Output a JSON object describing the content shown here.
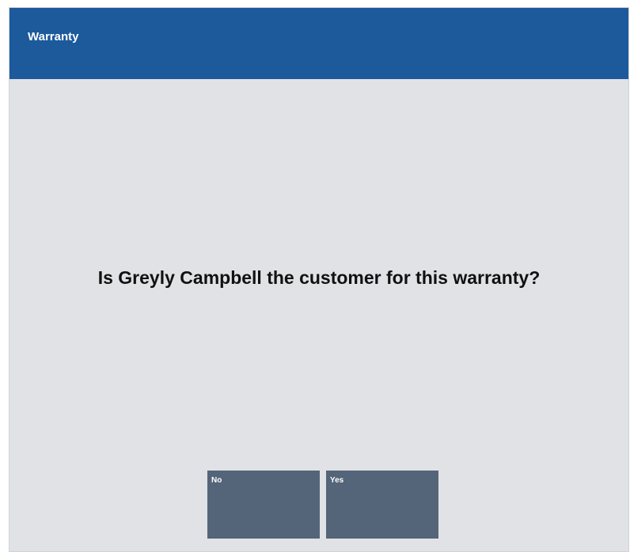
{
  "dialog": {
    "title": "Warranty",
    "prompt": "Is Greyly Campbell the customer for this warranty?"
  },
  "buttons": {
    "no_label": "No",
    "yes_label": "Yes"
  },
  "colors": {
    "title_bar": "#1c5a9c",
    "background": "#e0e2e5",
    "button": "#546479",
    "button_text": "#ffffff",
    "prompt_text": "#111111"
  }
}
